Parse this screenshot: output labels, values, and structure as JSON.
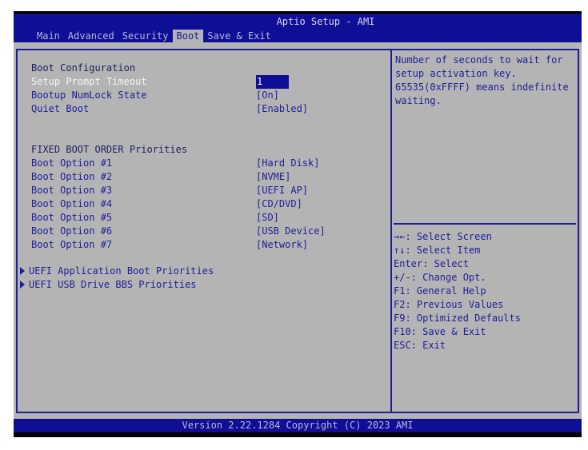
{
  "title": "Aptio Setup - AMI",
  "tabs": [
    "Main",
    "Advanced",
    "Security",
    "Boot",
    "Save & Exit"
  ],
  "active_tab": "Boot",
  "section1": "Boot Configuration",
  "settings": [
    {
      "label": "Setup Prompt Timeout",
      "value": "1"
    },
    {
      "label": "Bootup NumLock State",
      "value": "[On]"
    },
    {
      "label": "Quiet Boot",
      "value": "[Enabled]"
    }
  ],
  "section2": "FIXED BOOT ORDER Priorities",
  "boot_options": [
    {
      "label": "Boot Option #1",
      "value": "[Hard Disk]"
    },
    {
      "label": "Boot Option #2",
      "value": "[NVME]"
    },
    {
      "label": "Boot Option #3",
      "value": "[UEFI AP]"
    },
    {
      "label": "Boot Option #4",
      "value": "[CD/DVD]"
    },
    {
      "label": "Boot Option #5",
      "value": "[SD]"
    },
    {
      "label": "Boot Option #6",
      "value": "[USB Device]"
    },
    {
      "label": "Boot Option #7",
      "value": "[Network]"
    }
  ],
  "submenus": [
    "UEFI Application Boot Priorities",
    "UEFI USB Drive BBS Priorities"
  ],
  "help_text": "Number of seconds to wait for setup activation key. 65535(0xFFFF) means indefinite waiting.",
  "keys": [
    "→←: Select Screen",
    "↑↓: Select Item",
    "Enter: Select",
    "+/-: Change Opt.",
    "F1: General Help",
    "F2: Previous Values",
    "F9: Optimized Defaults",
    "F10: Save & Exit",
    "ESC: Exit"
  ],
  "footer": "Version 2.22.1284 Copyright (C) 2023 AMI"
}
